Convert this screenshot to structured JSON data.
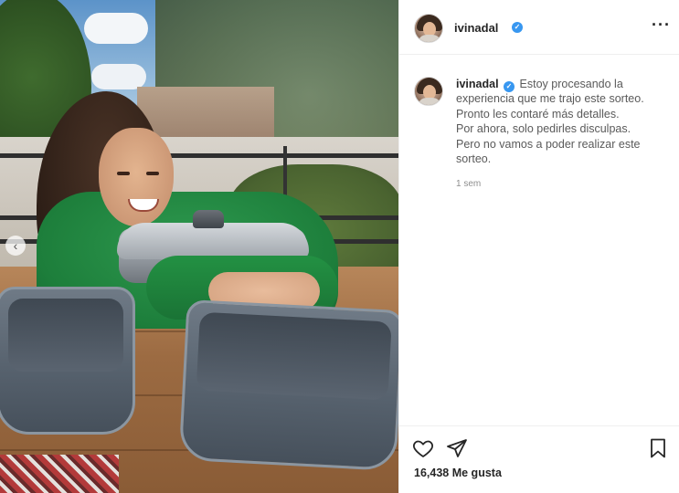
{
  "post": {
    "username": "ivinadal",
    "verified": true,
    "caption_lines": [
      "Estoy procesando la",
      "experiencia que me trajo este sorteo.",
      "Pronto les contaré más detalles.",
      "Por ahora, solo pedirles disculpas.",
      "Pero no vamos a poder realizar este",
      "sorteo."
    ],
    "timestamp": "1 sem",
    "likes_count": "16,438",
    "likes_label": "Me gusta"
  },
  "icons": {
    "more": "more-horizontal-icon",
    "heart": "heart-icon",
    "share": "send-icon",
    "save": "bookmark-icon",
    "verified": "verified-badge-icon",
    "carousel_prev": "chevron-left-icon"
  },
  "colors": {
    "verified_blue": "#3897f0",
    "text_primary": "#262626",
    "text_secondary": "#8e8e8e",
    "border": "#efefef"
  }
}
